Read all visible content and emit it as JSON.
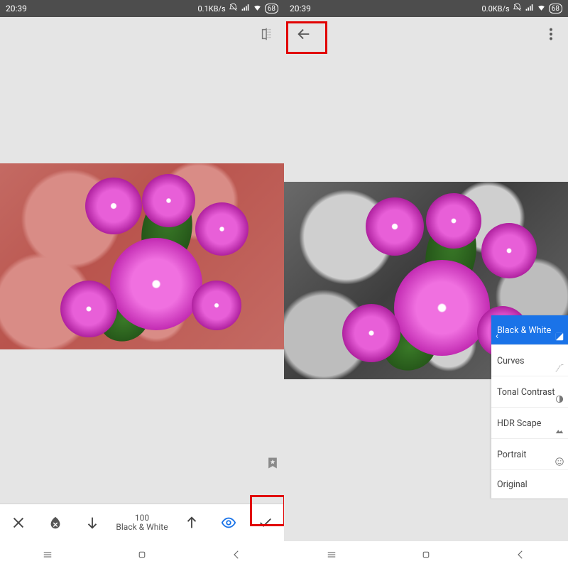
{
  "status": {
    "time": "20:39",
    "left_kb": "0.1KB/s",
    "right_kb": "0.0KB/s",
    "battery": "68"
  },
  "left_screen": {
    "toolbar": {
      "value": "100",
      "filter_name": "Black & White"
    }
  },
  "right_screen": {
    "fx": {
      "items": [
        {
          "label": "Black & White",
          "selected": true,
          "icon": "bw"
        },
        {
          "label": "Curves",
          "selected": false,
          "icon": "curves"
        },
        {
          "label": "Tonal Contrast",
          "selected": false,
          "icon": "tonal"
        },
        {
          "label": "HDR Scape",
          "selected": false,
          "icon": "hdr"
        },
        {
          "label": "Portrait",
          "selected": false,
          "icon": "portrait"
        },
        {
          "label": "Original",
          "selected": false,
          "icon": ""
        }
      ]
    }
  }
}
